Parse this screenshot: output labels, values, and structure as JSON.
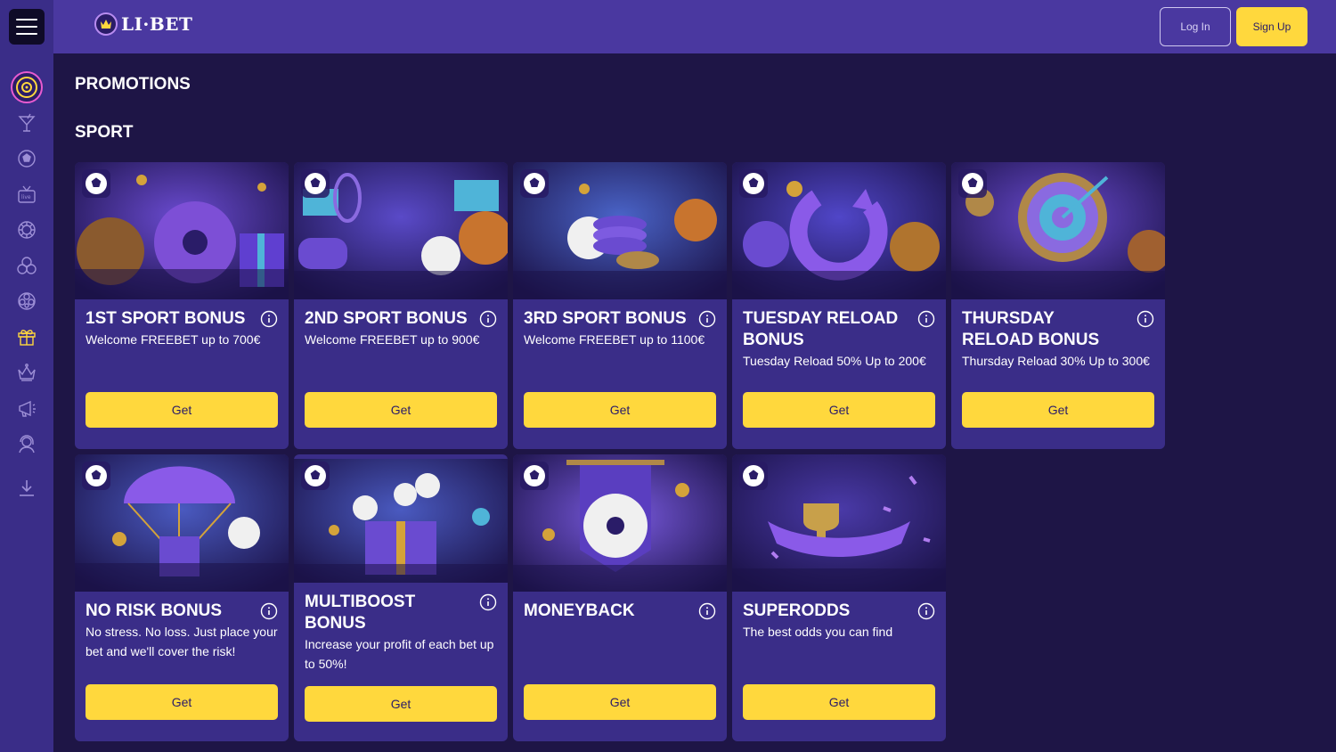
{
  "header": {
    "brand": "LI·BET",
    "login_label": "Log In",
    "signup_label": "Sign Up"
  },
  "sidebar": {
    "icons": [
      "target-icon",
      "cocktail-icon",
      "soccer-ball-icon",
      "live-tv-icon",
      "roulette-icon",
      "balls-icon",
      "pinwheel-icon",
      "gift-icon",
      "crown-icon",
      "megaphone-icon",
      "support-agent-icon",
      "download-icon"
    ]
  },
  "main": {
    "page_title": "PROMOTIONS",
    "section_title": "SPORT",
    "get_label": "Get",
    "cards": [
      {
        "title": "1ST SPORT BONUS",
        "desc": "Welcome FREEBET up to 700€"
      },
      {
        "title": "2ND SPORT BONUS",
        "desc": "Welcome FREEBET up to 900€"
      },
      {
        "title": "3RD SPORT BONUS",
        "desc": "Welcome FREEBET up to 1100€"
      },
      {
        "title": "TUESDAY RELOAD BONUS",
        "desc": "Tuesday Reload 50% Up to 200€"
      },
      {
        "title": "THURSDAY RELOAD BONUS",
        "desc": "Thursday Reload 30% Up to 300€"
      },
      {
        "title": "NO RISK BONUS",
        "desc": "No stress. No loss. Just place your bet and we'll cover the risk!"
      },
      {
        "title": "MULTIBOOST BONUS",
        "desc": "Increase your profit of each bet up to 50%!"
      },
      {
        "title": "MONEYBACK",
        "desc": ""
      },
      {
        "title": "SUPERODDS",
        "desc": "The best odds you can find"
      }
    ]
  },
  "colors": {
    "background": "#1e1546",
    "sidebar": "#3a2d88",
    "header": "#4a38a0",
    "card": "#3a2d88",
    "accent": "#ffd83d"
  }
}
